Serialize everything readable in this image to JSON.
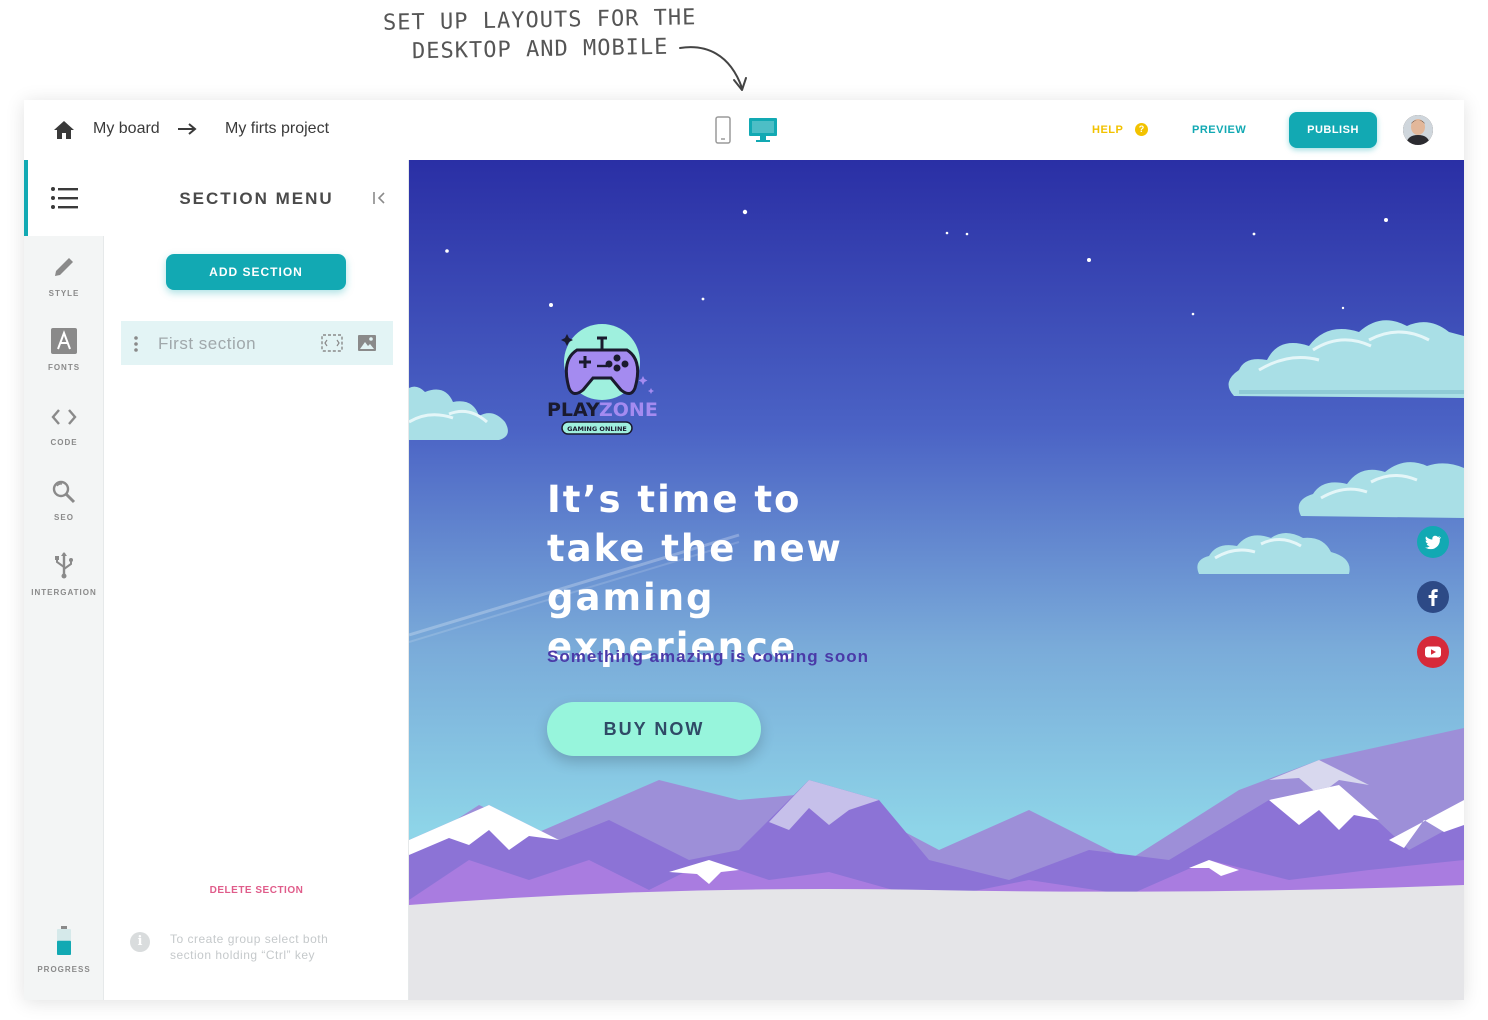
{
  "annotation": {
    "line1": "SET UP LAYOUTS FOR THE",
    "line2": "DESKTOP AND MOBILE"
  },
  "topbar": {
    "breadcrumb": [
      "My board",
      "My firts project"
    ],
    "help_label": "HELP",
    "help_icon_glyph": "?",
    "preview_label": "PREVIEW",
    "publish_label": "PUBLISH",
    "active_device": "desktop"
  },
  "rail": {
    "items": [
      {
        "label": "STYLE",
        "icon": "pencil-icon"
      },
      {
        "label": "FONTS",
        "icon": "font-icon"
      },
      {
        "label": "CODE",
        "icon": "code-icon"
      },
      {
        "label": "SEO",
        "icon": "search-icon"
      },
      {
        "label": "INTERGATION",
        "icon": "usb-icon"
      }
    ],
    "progress_label": "PROGRESS",
    "progress_fraction": 0.55
  },
  "panel": {
    "title": "SECTION MENU",
    "add_section_label": "ADD SECTION",
    "sections": [
      {
        "name": "First section"
      }
    ],
    "delete_label": "DELETE SECTION",
    "hint": "To create group select both section holding “Ctrl” key"
  },
  "site": {
    "logo_word_1": "PLAY",
    "logo_word_2": "ZONE",
    "logo_tagline": "GAMING ONLINE",
    "headline": "It’s time to take the new gaming experience",
    "subline": "Something amazing is coming soon",
    "cta_label": "BUY NOW",
    "social": [
      {
        "name": "twitter",
        "color": "#12a9b3"
      },
      {
        "name": "facebook",
        "color": "#2d4a86"
      },
      {
        "name": "youtube",
        "color": "#d62a3a"
      }
    ]
  },
  "colors": {
    "accent": "#12a9b3",
    "help": "#f2c200",
    "delete": "#e05c8a",
    "cta": "#97f5dc"
  }
}
